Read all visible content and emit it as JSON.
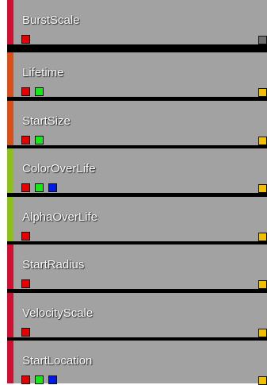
{
  "colors": {
    "panel_bg": "#a2a2a2",
    "separator": "#000000",
    "stripe_crimson": "#d10f33",
    "stripe_orange": "#d94e19",
    "stripe_green": "#8ec01d",
    "pin_red": "#e60000",
    "pin_green": "#19e619",
    "pin_blue": "#0019e6",
    "out_pin_yellow": "#f0c000",
    "out_pin_gray": "#6e6e6e"
  },
  "rows": [
    {
      "label": "BurstScale",
      "stripe": "#d10f33",
      "pins": [
        "red"
      ],
      "out_pin": "gray"
    },
    {
      "label": "Lifetime",
      "stripe": "#d94e19",
      "pins": [
        "red",
        "green"
      ],
      "out_pin": "yellow"
    },
    {
      "label": "StartSize",
      "stripe": "#d94e19",
      "pins": [
        "red",
        "green"
      ],
      "out_pin": "yellow"
    },
    {
      "label": "ColorOverLife",
      "stripe": "#8ec01d",
      "pins": [
        "red",
        "green",
        "blue"
      ],
      "out_pin": "yellow"
    },
    {
      "label": "AlphaOverLife",
      "stripe": "#8ec01d",
      "pins": [
        "red"
      ],
      "out_pin": "yellow"
    },
    {
      "label": "StartRadius",
      "stripe": "#d10f33",
      "pins": [
        "red"
      ],
      "out_pin": "yellow"
    },
    {
      "label": "VelocityScale",
      "stripe": "#d10f33",
      "pins": [
        "red"
      ],
      "out_pin": "yellow"
    },
    {
      "label": "StartLocation",
      "stripe": "#d10f33",
      "pins": [
        "red",
        "green",
        "blue"
      ],
      "out_pin": "yellow"
    }
  ]
}
